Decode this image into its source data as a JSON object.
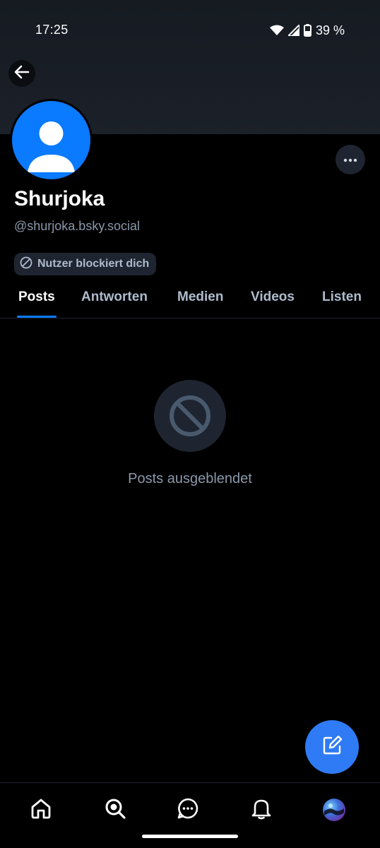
{
  "status_bar": {
    "time": "17:25",
    "battery": "39 %"
  },
  "profile": {
    "display_name": "Shurjoka",
    "handle": "@shurjoka.bsky.social",
    "block_badge": "Nutzer blockiert dich"
  },
  "tabs": [
    {
      "label": "Posts",
      "active": true
    },
    {
      "label": "Antworten",
      "active": false
    },
    {
      "label": "Medien",
      "active": false
    },
    {
      "label": "Videos",
      "active": false
    },
    {
      "label": "Listen",
      "active": false
    }
  ],
  "empty_state": {
    "text": "Posts ausgeblendet",
    "icon": "blocked-icon"
  },
  "bottom_nav": [
    "home-icon",
    "search-icon",
    "chat-icon",
    "bell-icon",
    "profile-avatar"
  ],
  "colors": {
    "accent": "#0a7aff",
    "fab": "#2f7bf6",
    "muted_text": "#8b98a9",
    "surface": "#1e2530"
  }
}
